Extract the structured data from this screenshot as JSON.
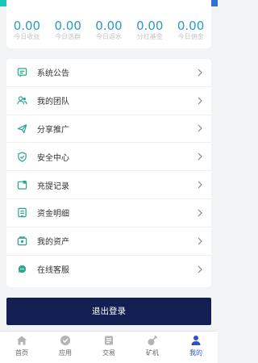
{
  "stats": [
    {
      "value": "0.00",
      "label": "今日收益"
    },
    {
      "value": "0.00",
      "label": "今日选群"
    },
    {
      "value": "0.00",
      "label": "今日返水"
    },
    {
      "value": "0.00",
      "label": "分红基金"
    },
    {
      "value": "0.00",
      "label": "今日佣金"
    }
  ],
  "menu": [
    {
      "label": "系统公告",
      "icon": "announcement-icon"
    },
    {
      "label": "我的团队",
      "icon": "team-icon"
    },
    {
      "label": "分享推广",
      "icon": "share-icon"
    },
    {
      "label": "安全中心",
      "icon": "shield-icon"
    },
    {
      "label": "充提记录",
      "icon": "record-icon"
    },
    {
      "label": "资金明细",
      "icon": "funds-detail-icon"
    },
    {
      "label": "我的资产",
      "icon": "assets-icon"
    },
    {
      "label": "在线客服",
      "icon": "customer-service-icon"
    }
  ],
  "logout_label": "退出登录",
  "tabs": [
    {
      "label": "首页",
      "icon": "home-icon",
      "active": false
    },
    {
      "label": "应用",
      "icon": "apps-icon",
      "active": false
    },
    {
      "label": "交易",
      "icon": "trade-icon",
      "active": false
    },
    {
      "label": "矿机",
      "icon": "miner-icon",
      "active": false
    },
    {
      "label": "我的",
      "icon": "profile-icon",
      "active": true
    }
  ],
  "colors": {
    "accent_value": "#2b9bc3",
    "menu_icon": "#2aa58f",
    "logout_bg": "#131f52",
    "tab_active": "#2b52c7",
    "tab_inactive": "#b4b4b4"
  }
}
